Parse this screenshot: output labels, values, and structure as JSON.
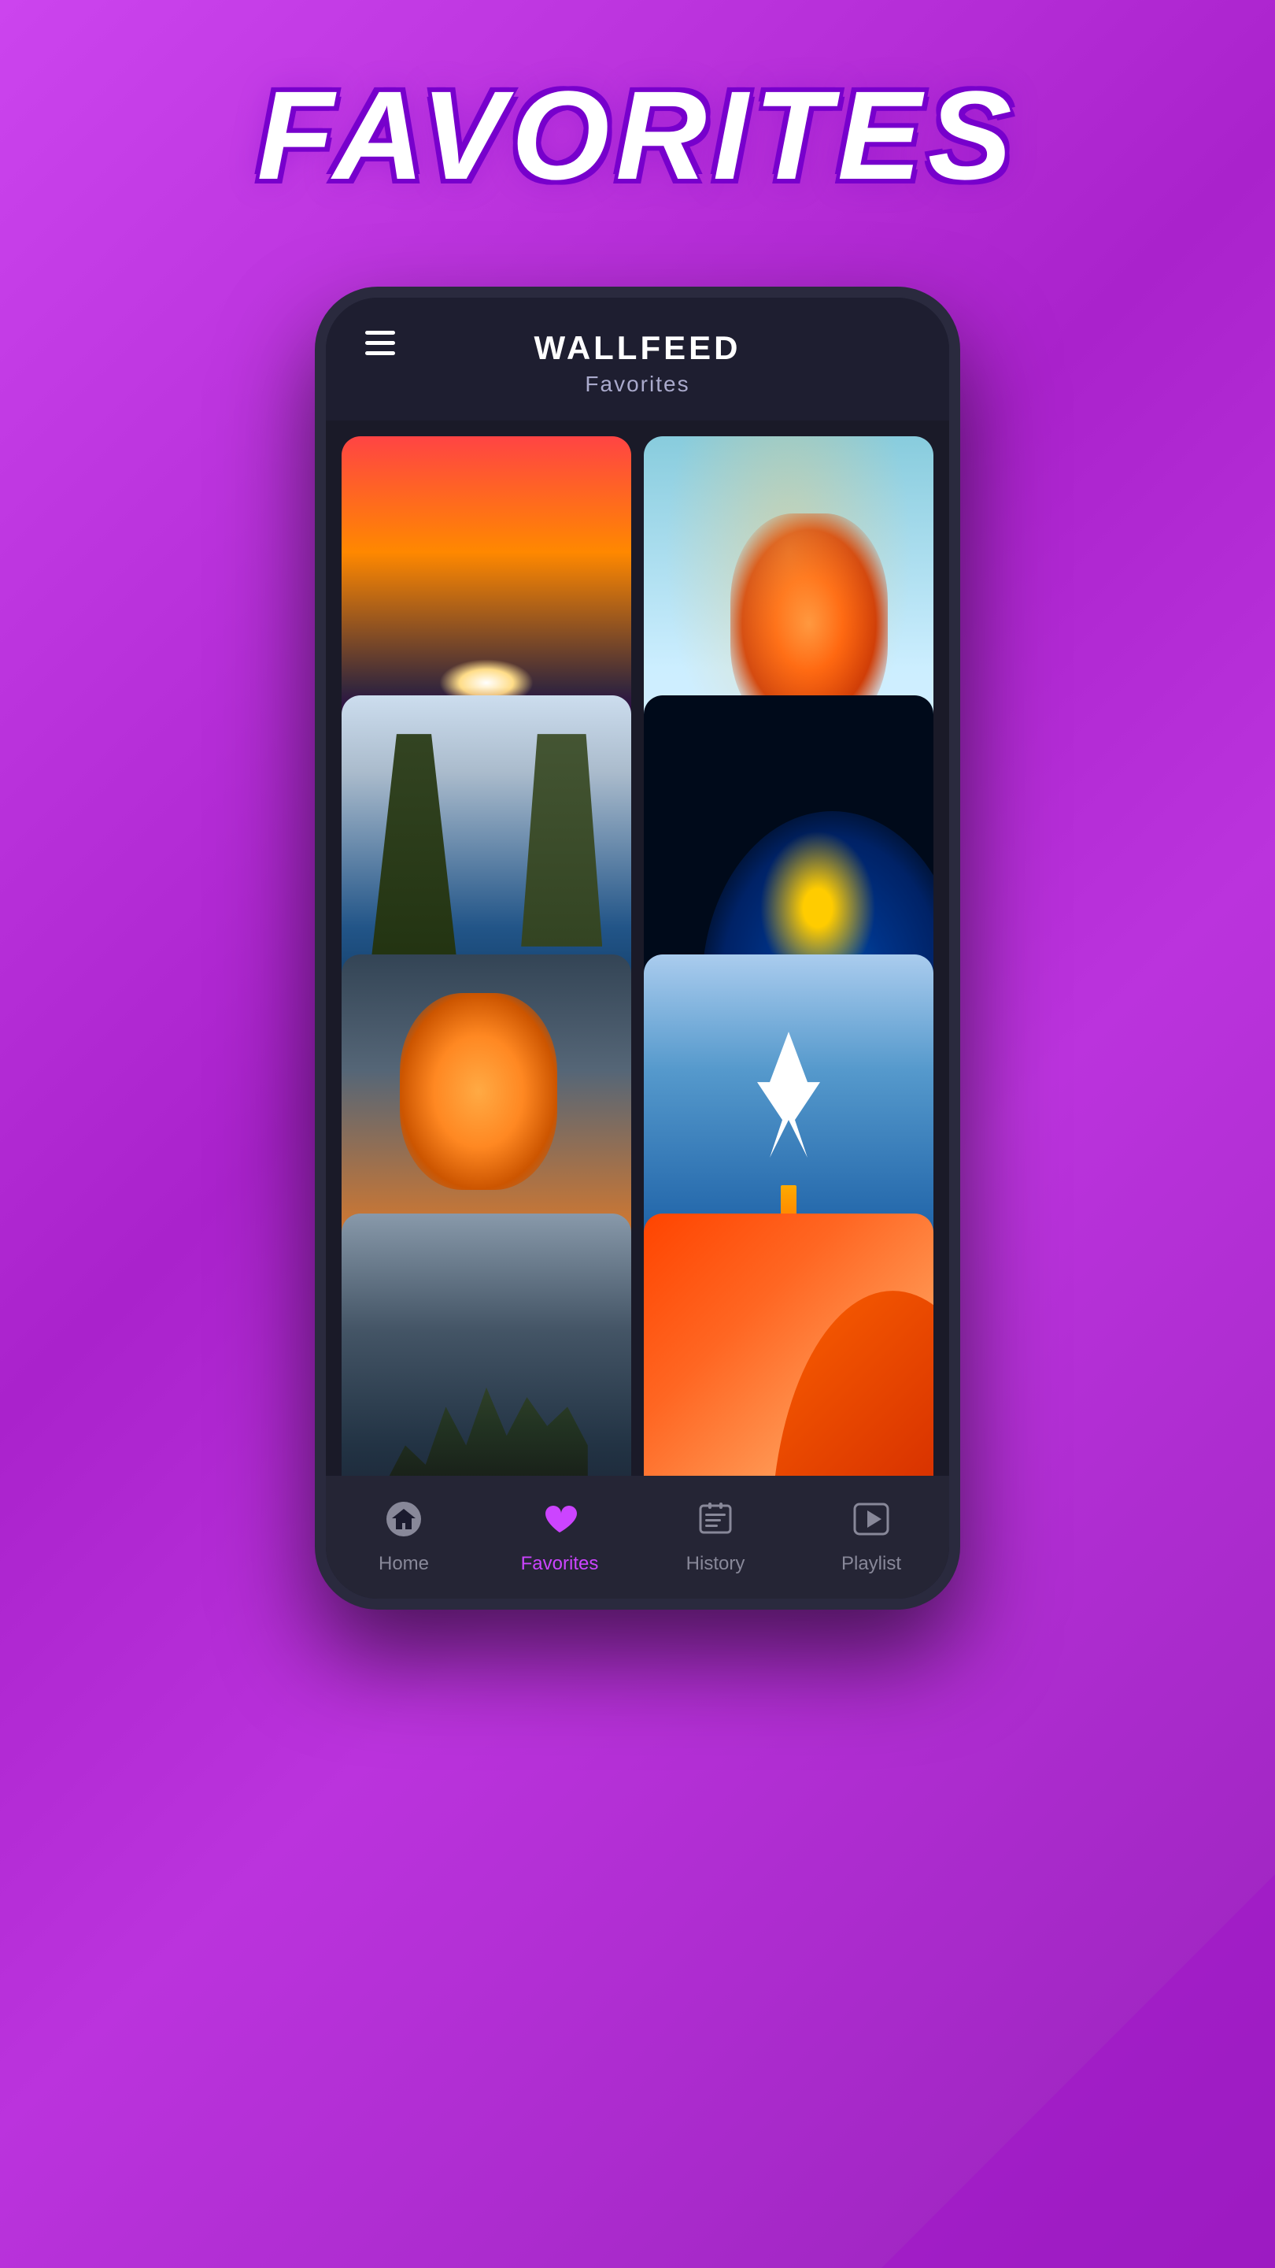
{
  "page": {
    "title": "FAVORITES",
    "background_color": "#bb33dd"
  },
  "app": {
    "logo": "WALLFEED",
    "subtitle": "Favorites"
  },
  "wallpapers": [
    {
      "id": "wp-1",
      "theme": "retrocar-sunset",
      "alt": "Retro car with sunset and cliffs"
    },
    {
      "id": "wp-2",
      "theme": "explosion-clouds",
      "alt": "Explosion clouds artwork"
    },
    {
      "id": "wp-3",
      "theme": "canyon-river",
      "alt": "Canyon with river"
    },
    {
      "id": "wp-4",
      "theme": "blue-flower",
      "alt": "Blue dahlia flower"
    },
    {
      "id": "wp-5",
      "theme": "orange-clouds",
      "alt": "Orange dramatic clouds"
    },
    {
      "id": "wp-6",
      "theme": "airplane-sky",
      "alt": "Airplane in blue sky with clouds"
    },
    {
      "id": "wp-7",
      "theme": "japanese-temple",
      "alt": "Japanese temple in mist"
    },
    {
      "id": "wp-8",
      "theme": "red-gradient",
      "alt": "Red orange gradient waves"
    }
  ],
  "nav": {
    "items": [
      {
        "id": "home",
        "label": "Home",
        "icon": "home-icon",
        "active": false
      },
      {
        "id": "favorites",
        "label": "Favorites",
        "icon": "heart-icon",
        "active": true
      },
      {
        "id": "history",
        "label": "History",
        "icon": "history-icon",
        "active": false
      },
      {
        "id": "playlist",
        "label": "Playlist",
        "icon": "playlist-icon",
        "active": false
      }
    ]
  },
  "hamburger": {
    "lines": 3
  }
}
